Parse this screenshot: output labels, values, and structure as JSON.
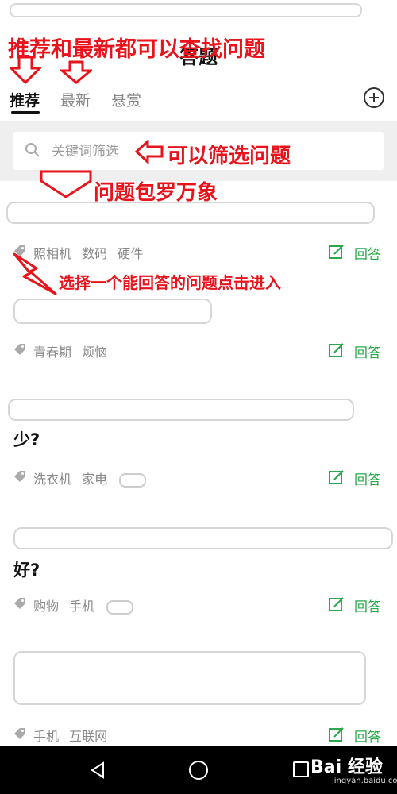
{
  "header": {
    "title": "答题"
  },
  "tabs": [
    {
      "label": "推荐",
      "active": true
    },
    {
      "label": "最新",
      "active": false
    },
    {
      "label": "悬赏",
      "active": false
    }
  ],
  "search": {
    "placeholder": "关键词筛选"
  },
  "questions": [
    {
      "title_redacted": true,
      "title_tail": "",
      "tags": [
        "照相机",
        "数码",
        "硬件"
      ],
      "answer_label": "回答"
    },
    {
      "title_redacted": true,
      "title_tail": "",
      "tags": [
        "青春期",
        "烦恼"
      ],
      "answer_label": "回答"
    },
    {
      "title_redacted": true,
      "title_tail": "少?",
      "tags": [
        "洗衣机",
        "家电"
      ],
      "answer_label": "回答"
    },
    {
      "title_redacted": true,
      "title_tail": "好?",
      "tags": [
        "购物",
        "手机"
      ],
      "answer_label": "回答"
    },
    {
      "title_redacted": true,
      "title_tail": "",
      "tags": [
        "手机",
        "互联网"
      ],
      "answer_label": "回答"
    }
  ],
  "annotations": {
    "tabs_note": "推荐和最新都可以查找问题",
    "search_note": "可以筛选问题",
    "list_note": "问题包罗万象",
    "select_note": "选择一个能回答的问题点击进入"
  },
  "watermark": {
    "brand": "Bai 经验",
    "url": "jingyan.baidu.com"
  },
  "colors": {
    "accent_green": "#2aa84a",
    "annotation_red": "#e8141b",
    "nav_black": "#000000"
  }
}
